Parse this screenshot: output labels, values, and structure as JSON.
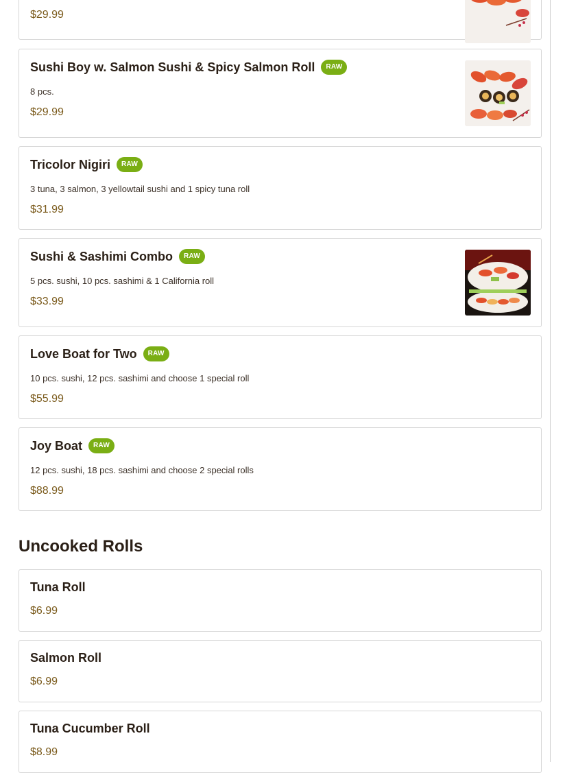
{
  "sections": [
    {
      "items": [
        {
          "price": "$29.99",
          "has_image": true,
          "image_icon": "sushi-plate-image"
        },
        {
          "name": "Sushi Boy w. Salmon Sushi & Spicy Salmon Roll",
          "badge": "RAW",
          "description": "8 pcs.",
          "price": "$29.99",
          "has_image": true,
          "image_icon": "sushi-plate-image"
        },
        {
          "name": "Tricolor Nigiri",
          "badge": "RAW",
          "description": "3 tuna, 3 salmon, 3 yellowtail sushi and 1 spicy tuna roll",
          "price": "$31.99",
          "has_image": false
        },
        {
          "name": "Sushi & Sashimi Combo",
          "badge": "RAW",
          "description": "5 pcs. sushi, 10 pcs. sashimi & 1 California roll",
          "price": "$33.99",
          "has_image": true,
          "image_icon": "sashimi-combo-image"
        },
        {
          "name": "Love Boat for Two",
          "badge": "RAW",
          "description": "10 pcs. sushi, 12 pcs. sashimi and choose 1 special roll",
          "price": "$55.99",
          "has_image": false
        },
        {
          "name": "Joy Boat",
          "badge": "RAW",
          "description": "12 pcs. sushi, 18 pcs. sashimi and choose 2 special rolls",
          "price": "$88.99",
          "has_image": false
        }
      ]
    },
    {
      "title": "Uncooked Rolls",
      "items": [
        {
          "name": "Tuna Roll",
          "price": "$6.99"
        },
        {
          "name": "Salmon Roll",
          "price": "$6.99"
        },
        {
          "name": "Tuna Cucumber Roll",
          "price": "$8.99"
        }
      ]
    }
  ],
  "colors": {
    "badge_bg": "#7aae14",
    "price_text": "#7a5a1b",
    "heading_text": "#2a1f16",
    "card_border": "#d6d6d6"
  }
}
